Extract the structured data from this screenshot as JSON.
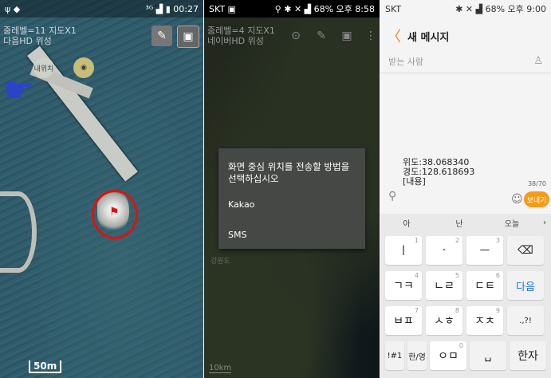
{
  "panel1": {
    "status": {
      "left": "ψ ◆",
      "signal": "³ᴳ",
      "time": "00:27"
    },
    "map_info": [
      "줌레벨=11 지도X1",
      "다음HD 위성"
    ],
    "marker_label": "내위치",
    "scale": "50m"
  },
  "panel2": {
    "status": {
      "left": "SKT ▣",
      "right": "68%  오후 8:58"
    },
    "map_info": [
      "줌레벨=4 지도X1",
      "네이버HD 위성"
    ],
    "dialog": {
      "title": "화면 중심 위치를 전송할 방법을 선택하십시오",
      "options": [
        "Kakao",
        "SMS"
      ]
    },
    "place_label": "강원도",
    "scale": "10km"
  },
  "panel3": {
    "status": {
      "carrier": "SKT",
      "right": "68%  오후 9:00"
    },
    "header": {
      "back": "〈",
      "title": "새 메시지"
    },
    "recipient_placeholder": "받는 사람",
    "message_lines": [
      "위도:38.068340",
      "경도:128.618693",
      "[내용]"
    ],
    "char_count": "38/70",
    "send_label": "보내기",
    "suggestions": [
      "아",
      "난",
      "오늘"
    ],
    "keys": [
      {
        "label": "ㅣ",
        "sup": "1"
      },
      {
        "label": "·",
        "sup": "2"
      },
      {
        "label": "ㅡ",
        "sup": "3"
      },
      {
        "label": "⌫",
        "sup": ""
      },
      {
        "label": "ㄱㅋ",
        "sup": "4"
      },
      {
        "label": "ㄴㄹ",
        "sup": "5"
      },
      {
        "label": "ㄷㅌ",
        "sup": "6"
      },
      {
        "label": "다음",
        "sup": ""
      },
      {
        "label": "ㅂㅍ",
        "sup": "7"
      },
      {
        "label": "ㅅㅎ",
        "sup": "8"
      },
      {
        "label": "ㅈㅊ",
        "sup": "9"
      },
      {
        "label": ".,?!",
        "sup": ""
      },
      {
        "label": "!#1",
        "sup": ""
      },
      {
        "label": "한/영",
        "sup": ""
      },
      {
        "label": "ㅇㅁ",
        "sup": "0"
      },
      {
        "label": "␣",
        "sup": ""
      },
      {
        "label": "한자",
        "sup": ""
      }
    ]
  },
  "colors": {
    "accent": "#f59b1a",
    "circle": "#e01010",
    "hand": "#2a43c9"
  }
}
